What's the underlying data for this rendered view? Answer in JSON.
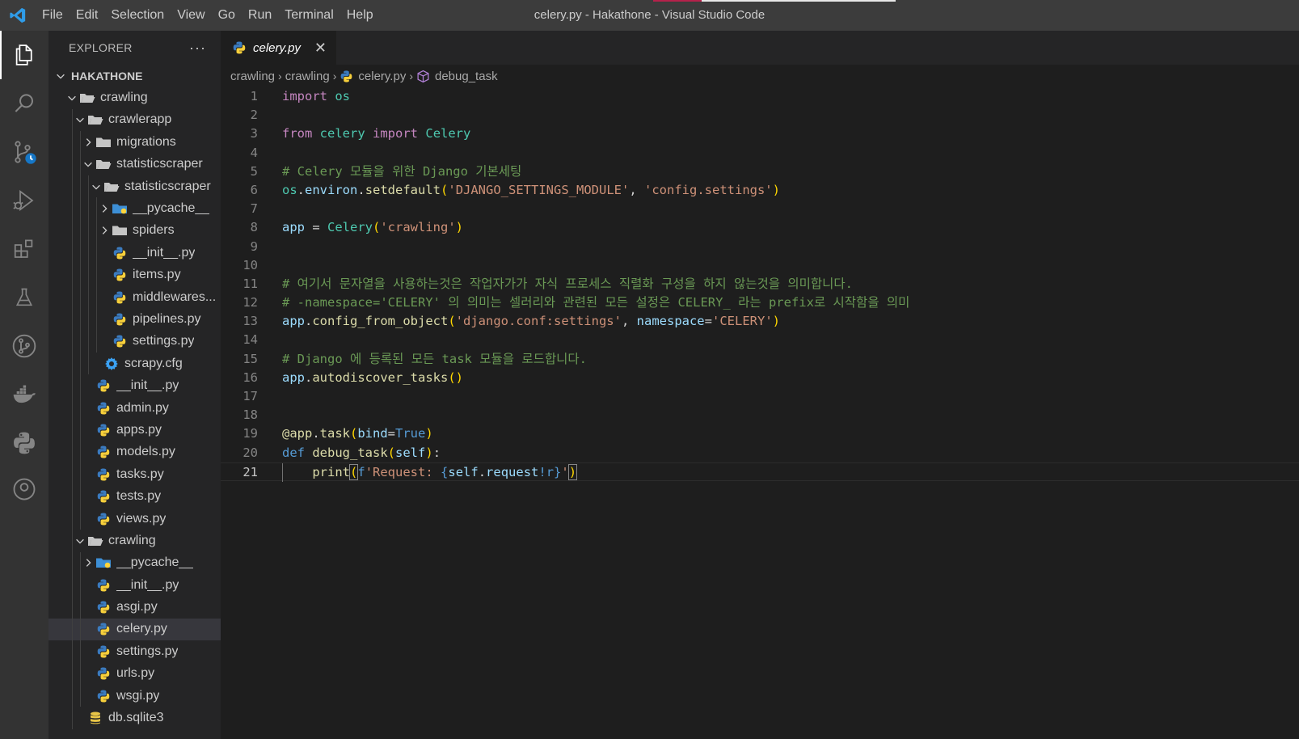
{
  "window": {
    "title": "celery.py - Hakathone - Visual Studio Code",
    "menu": [
      "File",
      "Edit",
      "Selection",
      "View",
      "Go",
      "Run",
      "Terminal",
      "Help"
    ]
  },
  "activity_bar": [
    "files-icon",
    "search-icon",
    "source-control-icon",
    "run-debug-icon",
    "extensions-icon",
    "testing-icon",
    "git-graph-icon",
    "docker-icon",
    "python-icon",
    "account-icon"
  ],
  "sidebar": {
    "header": "EXPLORER",
    "more": "···",
    "root": "HAKATHONE",
    "items": [
      {
        "label": "crawling",
        "type": "folder",
        "depth": 1,
        "expanded": true
      },
      {
        "label": "crawlerapp",
        "type": "folder",
        "depth": 2,
        "expanded": true
      },
      {
        "label": "migrations",
        "type": "folder",
        "depth": 3,
        "expanded": false
      },
      {
        "label": "statisticscraper",
        "type": "folder",
        "depth": 3,
        "expanded": true
      },
      {
        "label": "statisticscraper",
        "type": "folder",
        "depth": 4,
        "expanded": true
      },
      {
        "label": "__pycache__",
        "type": "pycache",
        "depth": 5,
        "expanded": false
      },
      {
        "label": "spiders",
        "type": "folder",
        "depth": 5,
        "expanded": false
      },
      {
        "label": "__init__.py",
        "type": "py",
        "depth": 5
      },
      {
        "label": "items.py",
        "type": "py",
        "depth": 5
      },
      {
        "label": "middlewares...",
        "type": "py",
        "depth": 5
      },
      {
        "label": "pipelines.py",
        "type": "py",
        "depth": 5
      },
      {
        "label": "settings.py",
        "type": "py",
        "depth": 5
      },
      {
        "label": "scrapy.cfg",
        "type": "cfg",
        "depth": 4
      },
      {
        "label": "__init__.py",
        "type": "py",
        "depth": 3
      },
      {
        "label": "admin.py",
        "type": "py",
        "depth": 3
      },
      {
        "label": "apps.py",
        "type": "py",
        "depth": 3
      },
      {
        "label": "models.py",
        "type": "py",
        "depth": 3
      },
      {
        "label": "tasks.py",
        "type": "py",
        "depth": 3
      },
      {
        "label": "tests.py",
        "type": "py",
        "depth": 3
      },
      {
        "label": "views.py",
        "type": "py",
        "depth": 3
      },
      {
        "label": "crawling",
        "type": "folder",
        "depth": 2,
        "expanded": true
      },
      {
        "label": "__pycache__",
        "type": "pycache",
        "depth": 3,
        "expanded": false
      },
      {
        "label": "__init__.py",
        "type": "py",
        "depth": 3
      },
      {
        "label": "asgi.py",
        "type": "py",
        "depth": 3
      },
      {
        "label": "celery.py",
        "type": "py",
        "depth": 3,
        "selected": true
      },
      {
        "label": "settings.py",
        "type": "py",
        "depth": 3
      },
      {
        "label": "urls.py",
        "type": "py",
        "depth": 3
      },
      {
        "label": "wsgi.py",
        "type": "py",
        "depth": 3
      },
      {
        "label": "db.sqlite3",
        "type": "db",
        "depth": 2
      }
    ]
  },
  "editor": {
    "tab": {
      "label": "celery.py",
      "close": "✕"
    },
    "breadcrumb": [
      "crawling",
      "crawling",
      "celery.py",
      "debug_task"
    ],
    "current_line": 21,
    "lines": [
      [
        [
          "kw",
          "import"
        ],
        [
          "plain",
          " "
        ],
        [
          "mod",
          "os"
        ]
      ],
      [],
      [
        [
          "kw",
          "from"
        ],
        [
          "plain",
          " "
        ],
        [
          "mod",
          "celery"
        ],
        [
          "plain",
          " "
        ],
        [
          "kw",
          "import"
        ],
        [
          "plain",
          " "
        ],
        [
          "cls",
          "Celery"
        ]
      ],
      [],
      [
        [
          "cmt",
          "# Celery 모듈을 위한 Django 기본세팅"
        ]
      ],
      [
        [
          "mod",
          "os"
        ],
        [
          "plain",
          "."
        ],
        [
          "var",
          "environ"
        ],
        [
          "plain",
          "."
        ],
        [
          "fn",
          "setdefault"
        ],
        [
          "p1",
          "("
        ],
        [
          "str",
          "'DJANGO_SETTINGS_MODULE'"
        ],
        [
          "plain",
          ", "
        ],
        [
          "str",
          "'config.settings'"
        ],
        [
          "p1",
          ")"
        ]
      ],
      [],
      [
        [
          "var",
          "app"
        ],
        [
          "plain",
          " = "
        ],
        [
          "cls",
          "Celery"
        ],
        [
          "p1",
          "("
        ],
        [
          "str",
          "'crawling'"
        ],
        [
          "p1",
          ")"
        ]
      ],
      [],
      [],
      [
        [
          "cmt",
          "# 여기서 문자열을 사용하는것은 작업자가가 자식 프로세스 직렬화 구성을 하지 않는것을 의미합니다."
        ]
      ],
      [
        [
          "cmt",
          "# -namespace='CELERY' 의 의미는 셀러리와 관련된 모든 설정은 CELERY_ 라는 prefix로 시작함을 의미"
        ]
      ],
      [
        [
          "var",
          "app"
        ],
        [
          "plain",
          "."
        ],
        [
          "fn",
          "config_from_object"
        ],
        [
          "p1",
          "("
        ],
        [
          "str",
          "'django.conf:settings'"
        ],
        [
          "plain",
          ", "
        ],
        [
          "var",
          "namespace"
        ],
        [
          "plain",
          "="
        ],
        [
          "str",
          "'CELERY'"
        ],
        [
          "p1",
          ")"
        ]
      ],
      [],
      [
        [
          "cmt",
          "# Django 에 등록된 모든 task 모듈을 로드합니다."
        ]
      ],
      [
        [
          "var",
          "app"
        ],
        [
          "plain",
          "."
        ],
        [
          "fn",
          "autodiscover_tasks"
        ],
        [
          "p1",
          "()"
        ]
      ],
      [],
      [],
      [
        [
          "fn",
          "@app"
        ],
        [
          "plain",
          "."
        ],
        [
          "fn",
          "task"
        ],
        [
          "p1",
          "("
        ],
        [
          "var",
          "bind"
        ],
        [
          "plain",
          "="
        ],
        [
          "kwb",
          "True"
        ],
        [
          "p1",
          ")"
        ]
      ],
      [
        [
          "kwb",
          "def"
        ],
        [
          "plain",
          " "
        ],
        [
          "fn",
          "debug_task"
        ],
        [
          "p1",
          "("
        ],
        [
          "var",
          "self"
        ],
        [
          "p1",
          ")"
        ],
        [
          "plain",
          ":"
        ]
      ],
      [
        [
          "plain",
          "    "
        ],
        [
          "fn",
          "print"
        ],
        [
          "p1",
          "("
        ],
        [
          "kwb",
          "f"
        ],
        [
          "str",
          "'Request: "
        ],
        [
          "esc",
          "{"
        ],
        [
          "var",
          "self"
        ],
        [
          "plain",
          "."
        ],
        [
          "var",
          "request"
        ],
        [
          "esc",
          "!r}"
        ],
        [
          "str",
          "'"
        ],
        [
          "p1",
          ")"
        ]
      ]
    ]
  },
  "colors": {
    "accent_blue": "#007acc",
    "python_blue": "#3776ab",
    "python_yellow": "#ffd43b",
    "folder": "#c5c5c5",
    "gear": "#3ba1f2",
    "db": "#e8c547"
  }
}
